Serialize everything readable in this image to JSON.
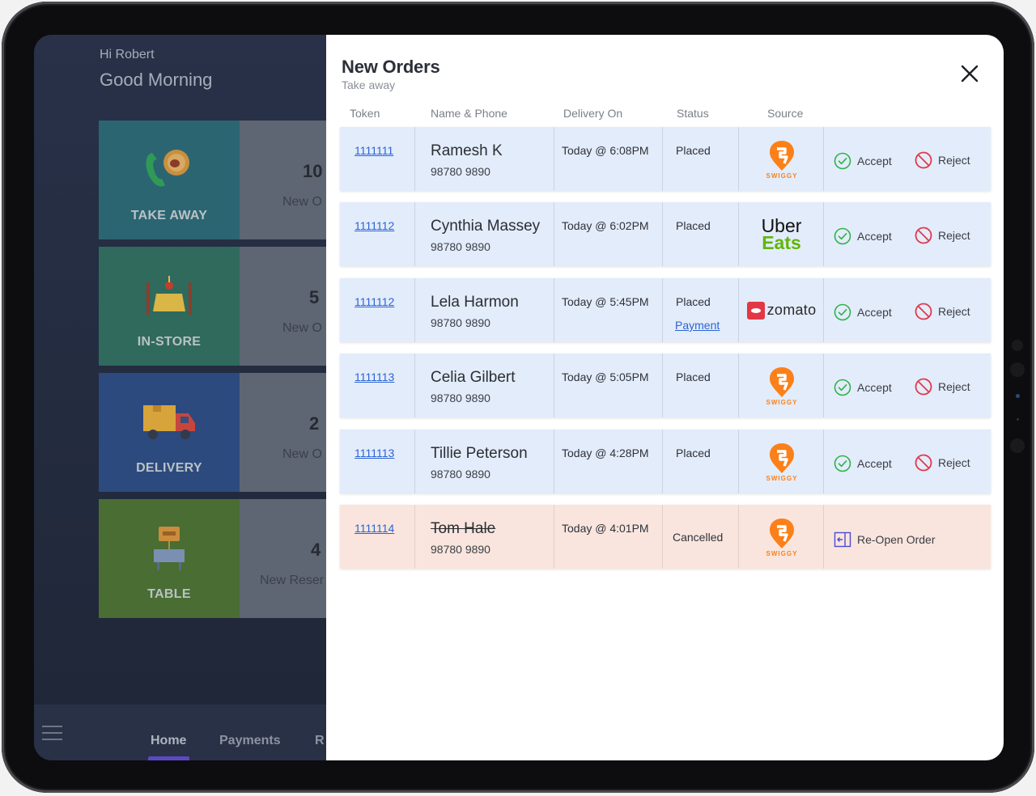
{
  "dashboard": {
    "greeting_name": "Hi Robert",
    "greeting_time": "Good Morning",
    "tiles": [
      {
        "label": "TAKE AWAY",
        "count": "10",
        "sub": "New O"
      },
      {
        "label": "IN-STORE",
        "count": "5",
        "sub": "New O"
      },
      {
        "label": "DELIVERY",
        "count": "2",
        "sub": "New O"
      },
      {
        "label": "TABLE",
        "count": "4",
        "sub": "New Reser"
      }
    ],
    "nav": {
      "home": "Home",
      "payments": "Payments",
      "partial": "R"
    }
  },
  "modal": {
    "title": "New Orders",
    "subtitle": "Take away",
    "columns": [
      "Token",
      "Name & Phone",
      "Delivery On",
      "Status",
      "Source"
    ],
    "actions": {
      "accept": "Accept",
      "reject": "Reject",
      "reopen": "Re-Open Order"
    },
    "orders": [
      {
        "token": "1111111",
        "name": "Ramesh K",
        "phone": "98780 9890",
        "delivery": "Today @ 6:08PM",
        "status": "Placed",
        "source": "swiggy"
      },
      {
        "token": "1111112",
        "name": "Cynthia Massey",
        "phone": "98780 9890",
        "delivery": "Today @ 6:02PM",
        "status": "Placed",
        "source": "ubereats"
      },
      {
        "token": "1111112",
        "name": "Lela Harmon",
        "phone": "98780 9890",
        "delivery": "Today @ 5:45PM",
        "status": "Placed",
        "payment_link": "Payment",
        "source": "zomato"
      },
      {
        "token": "1111113",
        "name": "Celia Gilbert",
        "phone": "98780 9890",
        "delivery": "Today @ 5:05PM",
        "status": "Placed",
        "source": "swiggy"
      },
      {
        "token": "1111113",
        "name": "Tillie Peterson",
        "phone": "98780 9890",
        "delivery": "Today @ 4:28PM",
        "status": "Placed",
        "source": "swiggy"
      },
      {
        "token": "1111114",
        "name": "Tom Hale",
        "phone": "98780 9890",
        "delivery": "Today @ 4:01PM",
        "status": "Cancelled",
        "source": "swiggy"
      }
    ]
  },
  "logos": {
    "swiggy": "SWIGGY",
    "uber_line1": "Uber",
    "uber_line2": "Eats",
    "zomato": "zomato"
  },
  "colors": {
    "swiggy_orange": "#fc8019",
    "uber_green": "#5fb709",
    "zomato_red": "#e23744",
    "accept_green": "#2db24a",
    "reject_red": "#e0394b",
    "link_blue": "#2a64d6",
    "reopen_purple": "#4b4bd1"
  }
}
